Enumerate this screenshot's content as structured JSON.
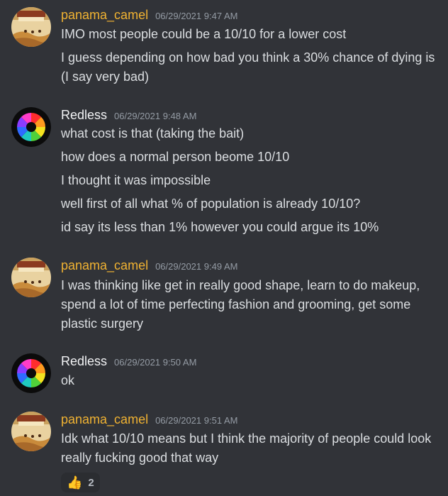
{
  "messages": [
    {
      "author": "panama_camel",
      "avatar": "camel-poster-avatar",
      "timestamp": "06/29/2021 9:47 AM",
      "lines": [
        "IMO most people could be a 10/10 for a lower cost",
        "I guess depending on how bad you think a 30% chance of dying is (I say very bad)"
      ]
    },
    {
      "author": "Redless",
      "avatar": "color-wheel-avatar",
      "timestamp": "06/29/2021 9:48 AM",
      "lines": [
        "what cost is that (taking the bait)",
        "how does a normal person beome 10/10",
        "I thought it was impossible",
        "well first of all what % of population is already 10/10?",
        "id say its less than 1% however you could argue its 10%"
      ]
    },
    {
      "author": "panama_camel",
      "avatar": "camel-poster-avatar",
      "timestamp": "06/29/2021 9:49 AM",
      "lines": [
        "I was thinking like get in really good shape, learn to do makeup, spend a lot of time perfecting fashion and grooming, get some plastic surgery"
      ]
    },
    {
      "author": "Redless",
      "avatar": "color-wheel-avatar",
      "timestamp": "06/29/2021 9:50 AM",
      "lines": [
        "ok"
      ]
    },
    {
      "author": "panama_camel",
      "avatar": "camel-poster-avatar",
      "timestamp": "06/29/2021 9:51 AM",
      "lines": [
        "Idk what 10/10 means but I think the majority of people could look really fucking good that way"
      ],
      "reaction": {
        "emoji": "👍",
        "emoji_name": "thumbs-up-icon",
        "count": "2"
      }
    }
  ],
  "colors": {
    "background": "#313338",
    "camel_name": "#f0b232",
    "redless_name": "#f2f3f5",
    "timestamp": "#949ba4",
    "text": "#dbdee1",
    "reaction_bg": "#2b2d31"
  }
}
